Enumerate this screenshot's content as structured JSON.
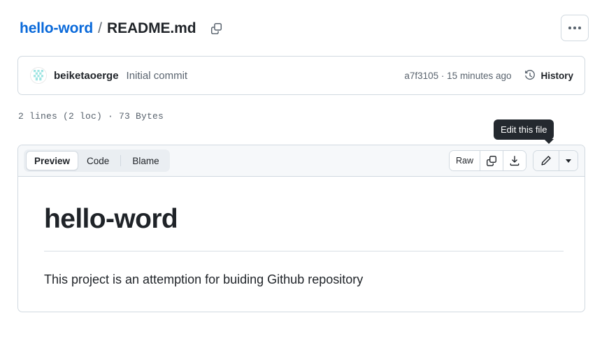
{
  "breadcrumb": {
    "repo": "hello-word",
    "separator": "/",
    "file": "README.md",
    "copy_path_icon": "copy-icon"
  },
  "header": {
    "more_options_label": "…"
  },
  "commit": {
    "author": "beiketaoerge",
    "message": "Initial commit",
    "sha": "a7f3105",
    "meta": "a7f3105 · 15 minutes ago",
    "relative_time": "15 minutes ago",
    "history_label": "History",
    "history_icon": "history-clock-icon"
  },
  "file_info": {
    "text": "2 lines (2 loc) · 73 Bytes",
    "lines": "2 lines",
    "loc": "2 loc",
    "size": "73 Bytes"
  },
  "toolbar": {
    "tabs": [
      {
        "label": "Preview",
        "active": true
      },
      {
        "label": "Code",
        "active": false
      },
      {
        "label": "Blame",
        "active": false
      }
    ],
    "raw_label": "Raw",
    "copy_icon": "copy-raw-icon",
    "download_icon": "download-icon",
    "edit_icon": "pencil-edit-icon",
    "edit_caret_icon": "chevron-down-icon"
  },
  "tooltip": {
    "text": "Edit this file"
  },
  "content": {
    "heading": "hello-word",
    "paragraph": "This project is an attemption for buiding Github repository"
  },
  "colors": {
    "link": "#0969da",
    "text": "#1f2328",
    "muted": "#59636e",
    "border": "#d1d9e0",
    "toolbar_bg": "#f6f8fa",
    "segment_bg": "#eaeef2",
    "tooltip_bg": "#24292f",
    "avatar_pattern": "#9fe5e3"
  }
}
